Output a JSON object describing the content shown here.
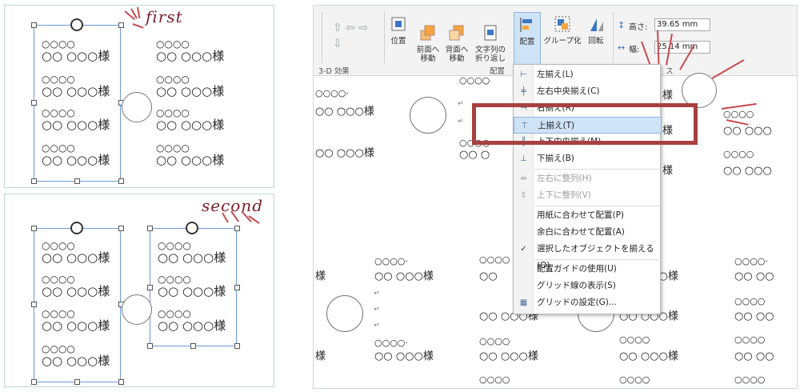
{
  "annotations": {
    "first": "first",
    "second": "second"
  },
  "labels": {
    "small": "○○○○",
    "big": "○○ ○○○様"
  },
  "ribbon": {
    "buttons": {
      "position": "位置",
      "bring_forward": "前面へ\n移動",
      "send_backward": "背面へ\n移動",
      "wrap_text": "文字列の\n折り返し",
      "align": "配置",
      "group": "グループ化",
      "rotate": "回転"
    },
    "groups": {
      "effects_3d": "3-D 効果",
      "arrange": "配置",
      "size": "ス"
    },
    "size": {
      "height_label": "高さ:",
      "height_value": "39.65 mm",
      "width_label": "幅:",
      "width_value": "25.14 mm"
    }
  },
  "align_menu": {
    "items": [
      {
        "label": "左揃え(L)",
        "icon": "align-left-icon",
        "disabled": false
      },
      {
        "label": "左右中央揃え(C)",
        "icon": "align-center-icon",
        "disabled": false
      },
      {
        "label": "右揃え(R)",
        "icon": "align-right-icon",
        "disabled": false
      },
      {
        "label": "上揃え(T)",
        "icon": "align-top-icon",
        "disabled": false,
        "highlighted": true
      },
      {
        "label": "上下中央揃え(M)",
        "icon": "align-middle-icon",
        "disabled": false
      },
      {
        "label": "下揃え(B)",
        "icon": "align-bottom-icon",
        "disabled": false
      },
      {
        "label": "左右に整列(H)",
        "icon": "distribute-horizontal-icon",
        "disabled": true
      },
      {
        "label": "上下に整列(V)",
        "icon": "distribute-vertical-icon",
        "disabled": true
      },
      {
        "label": "用紙に合わせて配置(P)",
        "icon": "",
        "disabled": false
      },
      {
        "label": "余白に合わせて配置(A)",
        "icon": "",
        "disabled": false
      },
      {
        "label": "選択したオブジェクトを揃える(O)",
        "icon": "check-icon",
        "disabled": false
      },
      {
        "label": "配置ガイドの使用(U)",
        "icon": "",
        "disabled": false
      },
      {
        "label": "グリッド線の表示(S)",
        "icon": "",
        "disabled": false
      },
      {
        "label": "グリッドの設定(G)...",
        "icon": "grid-settings-icon",
        "disabled": false
      }
    ]
  },
  "doc": {
    "mark_return": "↵",
    "row_big": "○○ ○○○様",
    "row_small": "○○○○"
  }
}
